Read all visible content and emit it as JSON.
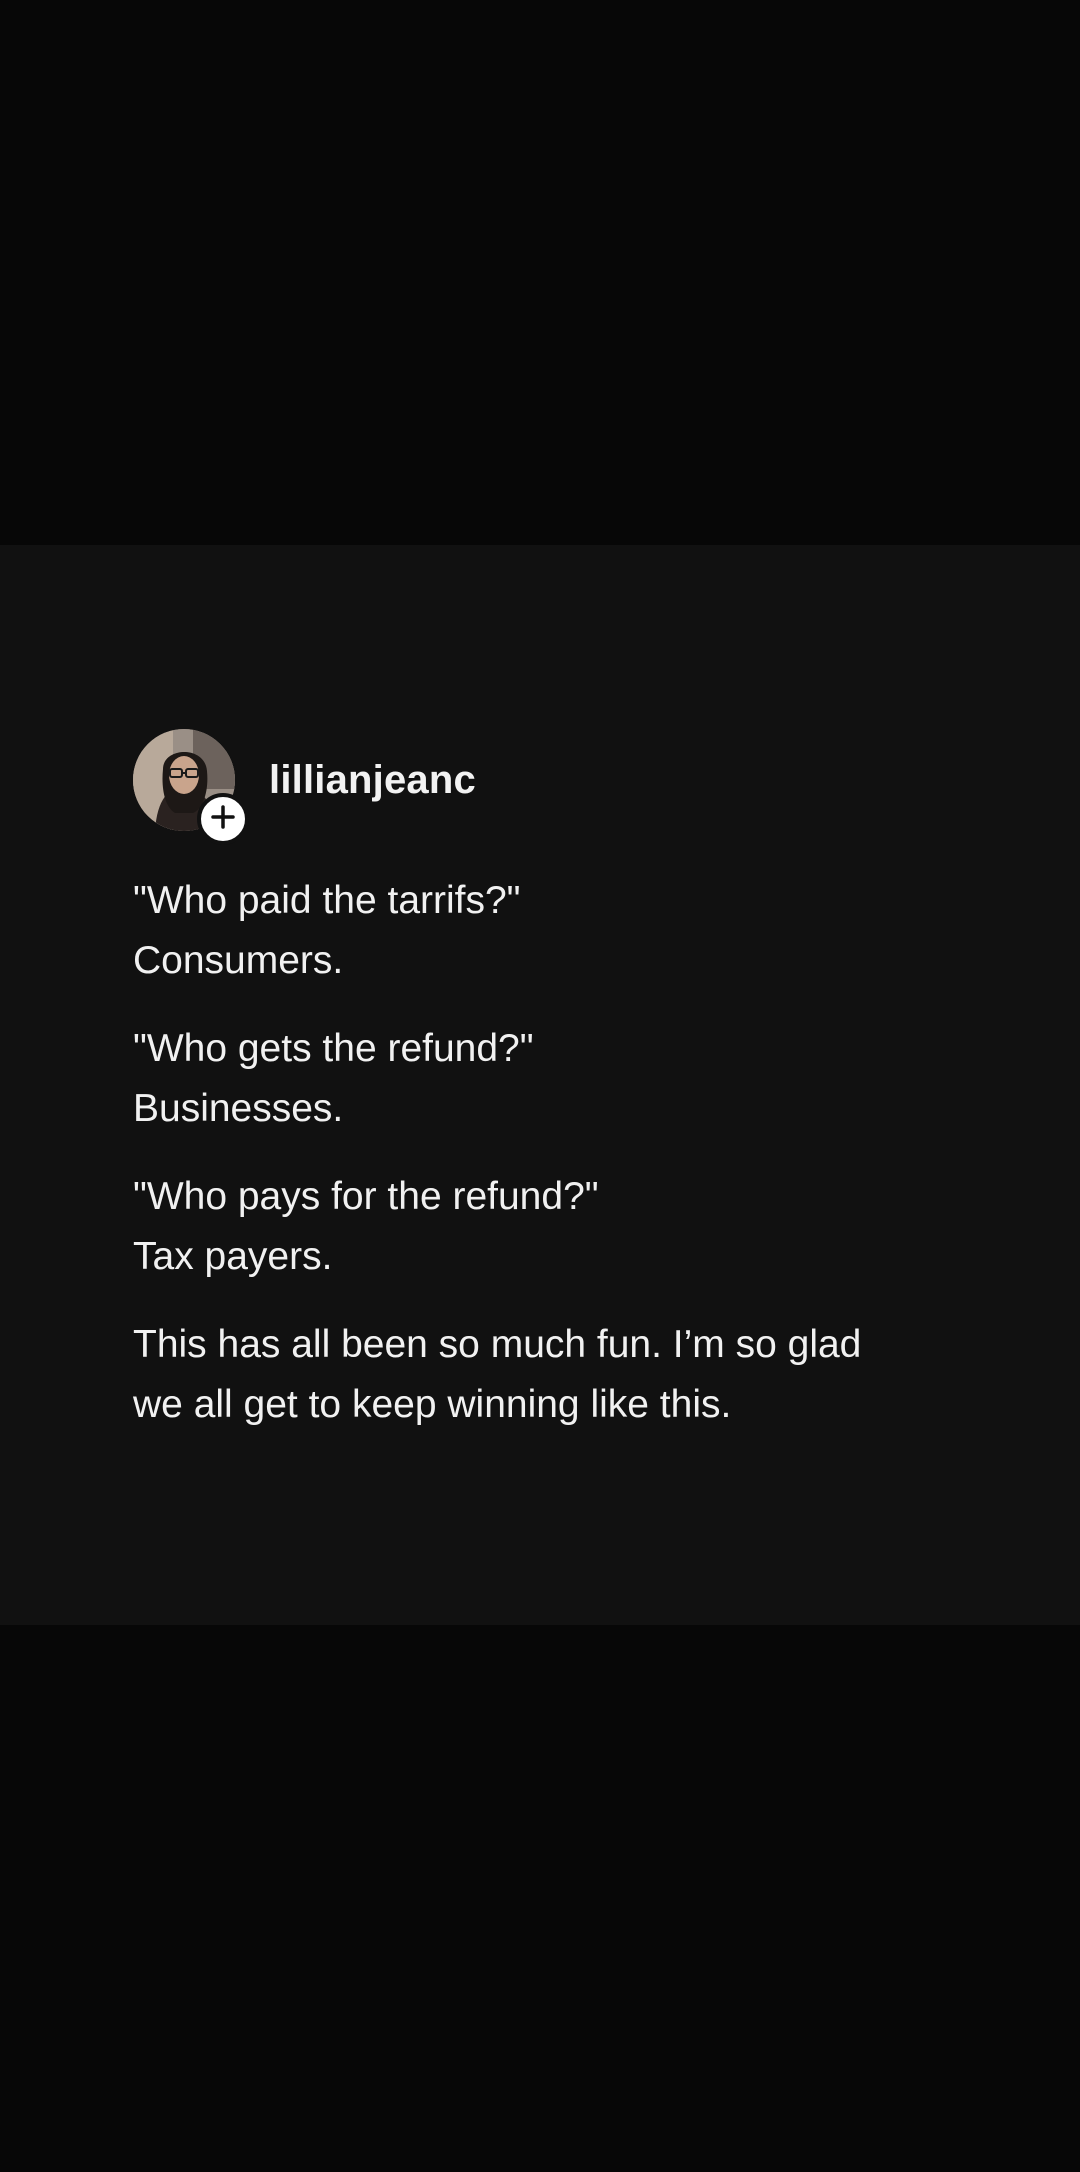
{
  "post": {
    "username": "lillianjeanc",
    "avatar_icon": "profile-photo",
    "follow_icon": "plus-icon",
    "paragraphs": [
      {
        "line1": "\"Who paid the tarrifs?\"",
        "line2": "Consumers."
      },
      {
        "line1": "\"Who gets the refund?\"",
        "line2": "Businesses."
      },
      {
        "line1": "\"Who pays for the refund?\"",
        "line2": "Tax payers."
      },
      {
        "line1": "This has all been so much fun. I’m so glad",
        "line2": "we all get to keep winning like this."
      }
    ]
  },
  "colors": {
    "background": "#070707",
    "card": "#111111",
    "text": "#f1f1f1",
    "badge": "#ffffff"
  }
}
